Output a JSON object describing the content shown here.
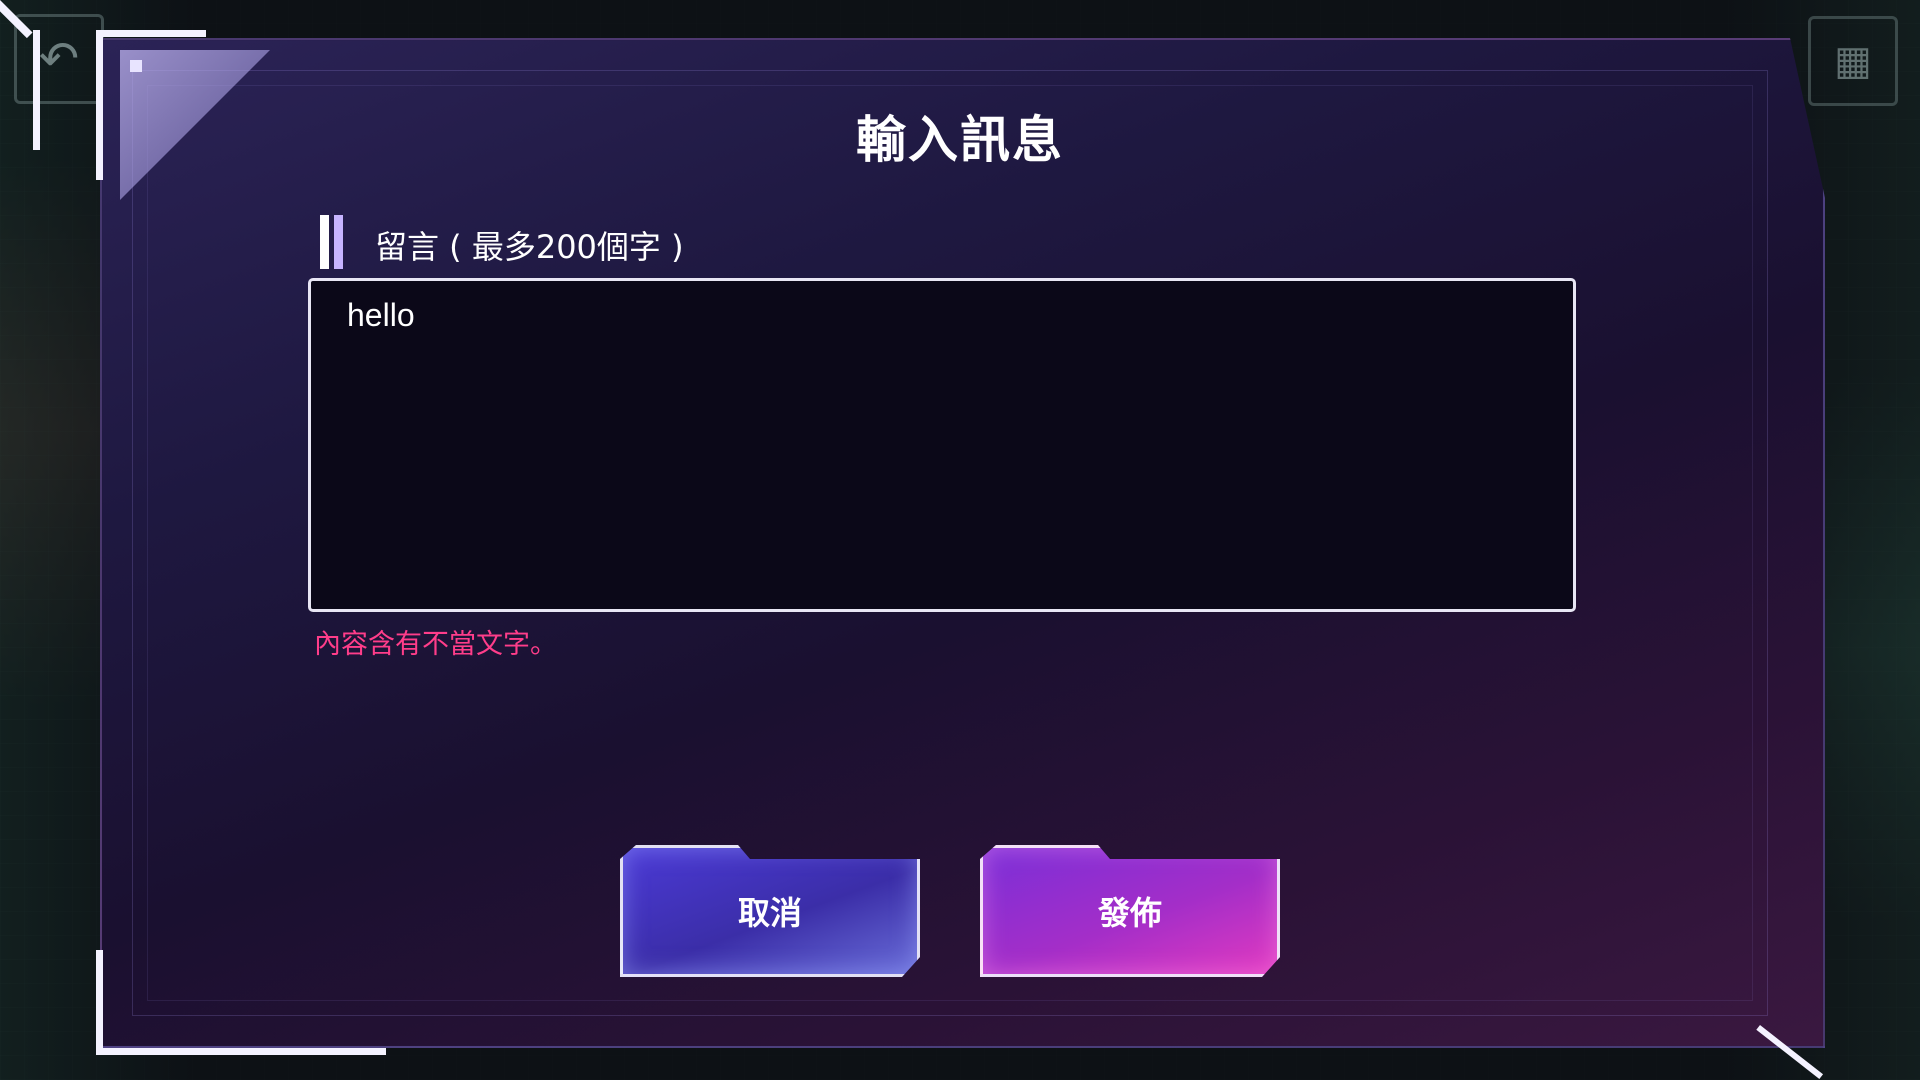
{
  "dialog": {
    "title": "輸入訊息",
    "field_label": "留言 ( 最多200個字 )",
    "input_value": "hello",
    "error_message": "內容含有不當文字。"
  },
  "buttons": {
    "cancel_label": "取消",
    "publish_label": "發佈"
  },
  "background_controls": {
    "back_icon": "back-arrow-icon",
    "menu_icon": "grid-menu-icon"
  },
  "colors": {
    "error": "#ff3d8a",
    "cancel_button": "#4b3ad6",
    "publish_button": "#c032c8"
  }
}
